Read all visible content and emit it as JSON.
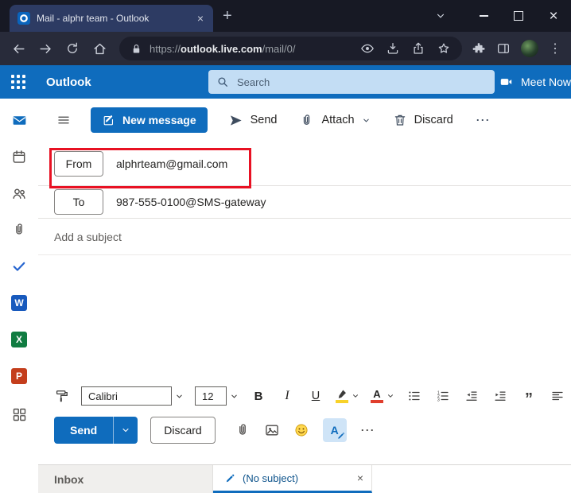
{
  "titlebar": {
    "tab_title": "Mail - alphr team - Outlook"
  },
  "address_bar": {
    "scheme": "https://",
    "host": "outlook.live.com",
    "path": "/mail/0/"
  },
  "outlook_header": {
    "app_name": "Outlook",
    "search_placeholder": "Search",
    "meet_label": "Meet Now"
  },
  "command_bar": {
    "new_message": "New message",
    "send": "Send",
    "attach": "Attach",
    "discard": "Discard",
    "more_glyph": "⋯"
  },
  "compose": {
    "from_label": "From",
    "from_address": "alphrteam@gmail.com",
    "to_label": "To",
    "to_address": "987-555-0100@SMS-gateway",
    "subject_placeholder": "Add a subject"
  },
  "format_bar": {
    "font_name": "Calibri",
    "font_size": "12",
    "bold": "B",
    "italic": "I",
    "underline": "U",
    "font_color_letter": "A",
    "quote": "”"
  },
  "compose_footer": {
    "send": "Send",
    "discard": "Discard",
    "ink_letter": "A",
    "more_glyph": "⋯"
  },
  "bottom_bar": {
    "folder": "Inbox",
    "draft_tab": "(No subject)"
  },
  "window_controls": {
    "new_tab_glyph": "+",
    "tab_close_glyph": "×",
    "close_glyph": "×",
    "kebab_glyph": "⋮",
    "draft_close_glyph": "×"
  },
  "icons": {
    "outlook-favicon": "blue tile with white O",
    "minimize-icon": "thin bar",
    "maximize-icon": "outline square",
    "chevron-down-icon": "⌄",
    "search-icon": "magnifier",
    "camera-icon": "video camera",
    "waffle-icon": "3x3 dots",
    "more-icons": "⋯ / ⋮",
    "quote-icon": "”"
  },
  "colors": {
    "outlook_blue": "#0f6cbd",
    "annotation_red": "#e81123",
    "search_pill_blue": "#c3ddf4",
    "highlight_yellow": "#f8d22a",
    "font_color_red": "#e03e2d",
    "word_blue": "#185abd",
    "excel_green": "#107c41",
    "powerpoint_orange": "#c43e1c",
    "todo_blue": "#2564cf"
  }
}
